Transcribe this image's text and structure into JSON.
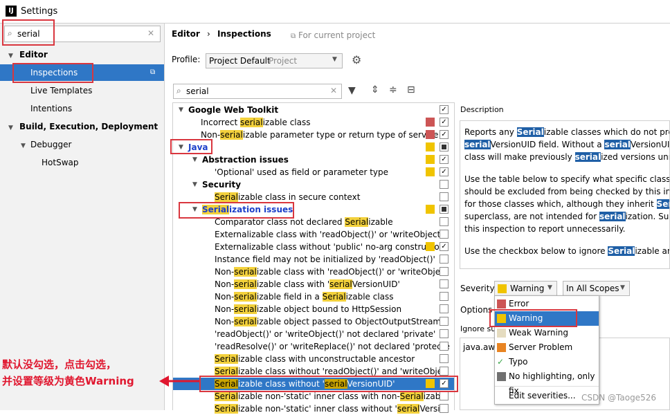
{
  "window": {
    "title": "Settings",
    "app_icon": "IJ"
  },
  "left": {
    "search_value": "serial",
    "tree": [
      {
        "label": "Editor",
        "bold": true
      },
      {
        "label": "Inspections",
        "selected": true
      },
      {
        "label": "Live Templates"
      },
      {
        "label": "Intentions"
      },
      {
        "label": "Build, Execution, Deployment",
        "bold": true
      },
      {
        "label": "Debugger"
      },
      {
        "label": "HotSwap"
      }
    ]
  },
  "header": {
    "crumb1": "Editor",
    "sep": "›",
    "crumb2": "Inspections",
    "project_note": "For current project"
  },
  "profile": {
    "label": "Profile:",
    "value": "Project Default",
    "scope": "Project"
  },
  "filter": {
    "value": "serial"
  },
  "colors": {
    "error": "#cc5555",
    "warning": "#f0c400",
    "weak": "#e5dcc0",
    "server": "#e88422",
    "none": "#707070",
    "accent": "#2f77c6",
    "annotation": "#e0172f"
  },
  "rows": [
    {
      "pre": "Google Web Toolkit",
      "bold": true,
      "arrow": "down"
    },
    {
      "pre": "Incorrect ",
      "hl": "serial",
      "post": "izable class"
    },
    {
      "pre": "Non-",
      "hl": "serial",
      "post": "izable parameter type or return type of service m"
    },
    {
      "pre": "Java",
      "bold": true,
      "arrow": "down"
    },
    {
      "pre": "Abstraction issues",
      "bold": true,
      "arrow": "down"
    },
    {
      "pre": "'Optional' used as field or parameter type"
    },
    {
      "pre": "Security",
      "bold": true,
      "arrow": "down"
    },
    {
      "pre": "",
      "hl": "Serial",
      "post": "izable class in secure context"
    },
    {
      "pre": "",
      "hl": "Serial",
      "post": "ization issues",
      "bold": true,
      "arrow": "down"
    },
    {
      "pre": "Comparator class not declared ",
      "hl": "Serial",
      "post": "izable"
    },
    {
      "pre": "Externalizable class with 'readObject()' or 'writeObject()'"
    },
    {
      "pre": "Externalizable class without 'public' no-arg constructor"
    },
    {
      "pre": "Instance field may not be initialized by 'readObject()'"
    },
    {
      "pre": "Non-",
      "hl": "serial",
      "post": "izable class with 'readObject()' or 'writeObjec"
    },
    {
      "pre": "Non-",
      "hl": "serial",
      "post": "izable class with '",
      "hl2": "serial",
      "post2": "VersionUID'"
    },
    {
      "pre": "Non-",
      "hl": "serial",
      "post": "izable field in a ",
      "hl2": "Serial",
      "post2": "izable class"
    },
    {
      "pre": "Non-",
      "hl": "serial",
      "post": "izable object bound to HttpSession"
    },
    {
      "pre": "Non-",
      "hl": "serial",
      "post": "izable object passed to ObjectOutputStream"
    },
    {
      "pre": "'readObject()' or 'writeObject()' not declared 'private'"
    },
    {
      "pre": "'readResolve()' or 'writeReplace()' not declared 'protecte"
    },
    {
      "pre": "",
      "hl": "Serial",
      "post": "izable class with unconstructable ancestor"
    },
    {
      "pre": "",
      "hl": "Serial",
      "post": "izable class without 'readObject()' and 'writeObjec"
    },
    {
      "pre": "",
      "hl": "Serial",
      "post": "izable class without '",
      "hl2": "serial",
      "post2": "VersionUID'"
    },
    {
      "pre": "",
      "hl": "Serial",
      "post": "izable non-'static' inner class with non-",
      "hl2": "Serial",
      "post2": "izabl"
    },
    {
      "pre": "",
      "hl": "Serial",
      "post": "izable non-'static' inner class without '",
      "hl2": "serial",
      "post2": "Versio"
    }
  ],
  "description": {
    "title": "Description",
    "lines": [
      [
        "Reports any ",
        "Serial",
        "izable classes which do not provide"
      ],
      [
        "",
        "serial",
        "VersionUID field. Without a ",
        "serial",
        "VersionUID fiel"
      ],
      [
        "class will make previously ",
        "serial",
        "ized versions unreada"
      ],
      [
        "Use the table below to specify what specific classes ar"
      ],
      [
        "should be excluded from being checked by this inspect"
      ],
      [
        "for those classes which, although they inherit ",
        "Serial",
        "iza"
      ],
      [
        "superclass, are not intended for ",
        "serial",
        "ization. Such cla"
      ],
      [
        "this inspection to report unnecessarily."
      ],
      [
        "Use the checkbox below to ignore ",
        "Serial",
        "izable anonym"
      ]
    ]
  },
  "severity": {
    "label": "Severity:",
    "value": "Warning",
    "scope": "In All Scopes"
  },
  "options": {
    "label": "Options",
    "ignore_label": "Ignore sub",
    "list_item": "java.awt."
  },
  "menu": {
    "items": [
      "Error",
      "Warning",
      "Weak Warning",
      "Server Problem",
      "Typo",
      "No highlighting, only fix",
      "Edit severities..."
    ]
  },
  "annotation": {
    "line1": "默认没勾选，点击勾选，",
    "line2": "并设置等级为黄色Warning"
  },
  "watermark": "CSDN @Taoge526"
}
